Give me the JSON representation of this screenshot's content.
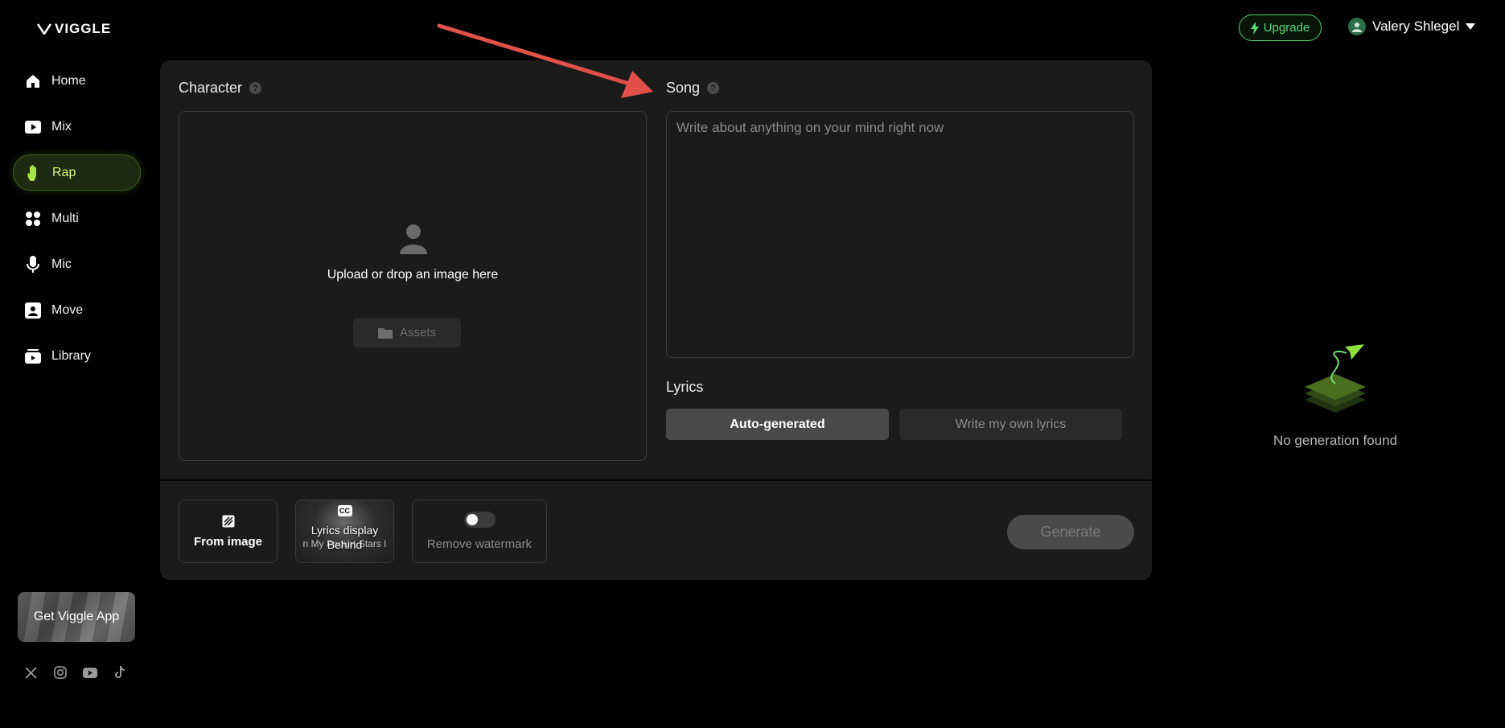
{
  "brand": {
    "name": "VIGGLE"
  },
  "sidebar": {
    "items": [
      {
        "label": "Home",
        "icon": "home-icon"
      },
      {
        "label": "Mix",
        "icon": "play-icon"
      },
      {
        "label": "Rap",
        "icon": "hand-icon",
        "active": true
      },
      {
        "label": "Multi",
        "icon": "grid-icon"
      },
      {
        "label": "Mic",
        "icon": "mic-icon"
      },
      {
        "label": "Move",
        "icon": "person-icon"
      },
      {
        "label": "Library",
        "icon": "library-icon"
      }
    ],
    "app_banner": "Get Viggle App",
    "socials": [
      "x-icon",
      "instagram-icon",
      "youtube-icon",
      "tiktok-icon"
    ]
  },
  "header": {
    "upgrade_label": "Upgrade",
    "user_name": "Valery Shlegel"
  },
  "main": {
    "character": {
      "title": "Character",
      "upload_text": "Upload or drop an image here",
      "assets_label": "Assets"
    },
    "song": {
      "title": "Song",
      "placeholder": "Write about anything on your mind right now"
    },
    "lyrics": {
      "title": "Lyrics",
      "options": [
        "Auto-generated",
        "Write my own lyrics"
      ],
      "selected": "Auto-generated"
    },
    "options": {
      "from_image": "From image",
      "lyrics_display": "Lyrics display",
      "lyrics_display_value": "Behind",
      "lyrics_scroll_text": "n My Pocket  Stars I",
      "remove_watermark": "Remove watermark"
    },
    "generate_label": "Generate"
  },
  "results": {
    "empty_text": "No generation found"
  },
  "colors": {
    "accent": "#8fe03a",
    "upgrade": "#57d977",
    "annotation_arrow": "#e2504a"
  }
}
